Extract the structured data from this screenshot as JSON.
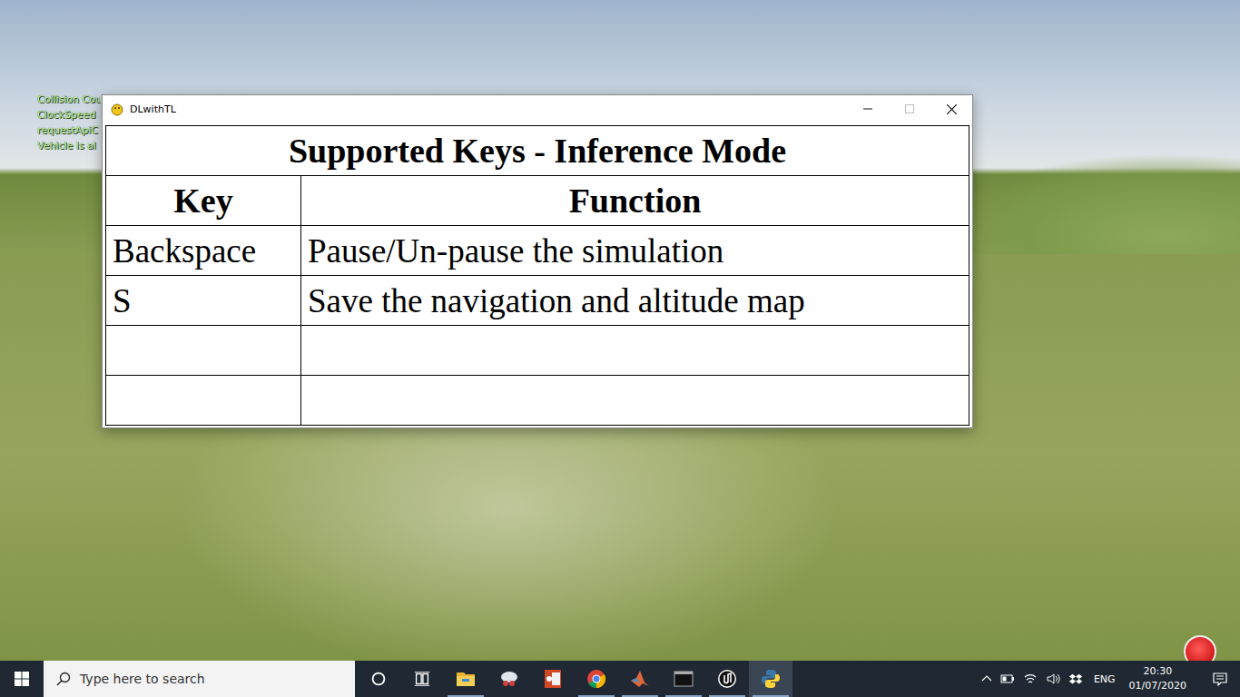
{
  "scene": {
    "overlay_lines": [
      "Collision Cou",
      "ClockSpeed",
      "requestApiC",
      "Vehicle is al"
    ]
  },
  "window": {
    "title": "DLwithTL"
  },
  "table": {
    "title": "Supported Keys - Inference Mode",
    "columns": [
      "Key",
      "Function"
    ],
    "rows": [
      {
        "key": "Backspace",
        "function": "Pause/Un-pause the simulation"
      },
      {
        "key": "S",
        "function": "Save the navigation and altitude map"
      },
      {
        "key": "",
        "function": ""
      },
      {
        "key": "",
        "function": ""
      }
    ]
  },
  "taskbar": {
    "search": {
      "placeholder": "Type here to search"
    },
    "apps": [
      {
        "kind": "cortana",
        "running": false,
        "selected": false
      },
      {
        "kind": "taskview",
        "running": false,
        "selected": false
      },
      {
        "kind": "explorer",
        "running": true,
        "selected": false
      },
      {
        "kind": "snipping",
        "running": false,
        "selected": false
      },
      {
        "kind": "powerpoint",
        "running": false,
        "selected": false
      },
      {
        "kind": "chrome",
        "running": true,
        "selected": false
      },
      {
        "kind": "matlab",
        "running": true,
        "selected": false
      },
      {
        "kind": "terminal",
        "running": true,
        "selected": false
      },
      {
        "kind": "unreal",
        "running": true,
        "selected": false
      },
      {
        "kind": "python",
        "running": true,
        "selected": true
      }
    ],
    "tray": {
      "language": "ENG",
      "time": "20:30",
      "date": "01/07/2020"
    }
  }
}
